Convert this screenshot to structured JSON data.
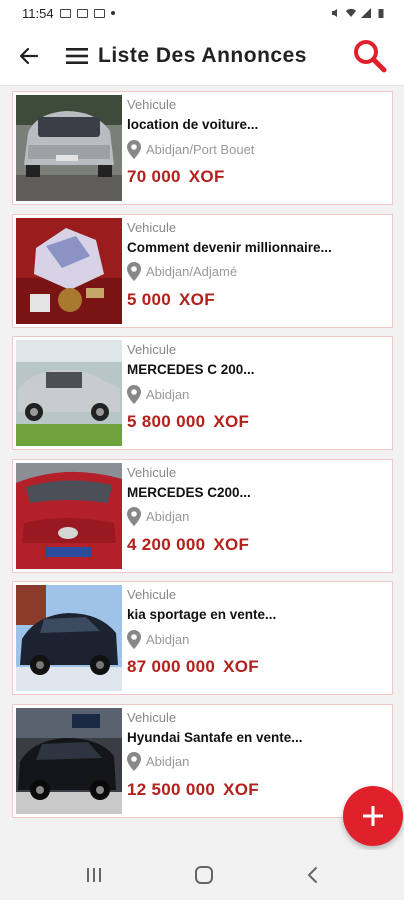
{
  "status": {
    "time": "11:54"
  },
  "header": {
    "title": "Liste Des Annonces"
  },
  "listings": [
    {
      "category": "Vehicule",
      "title": "location de voiture...",
      "location": "Abidjan/Port Bouet",
      "amount": "70 000",
      "currency": "XOF"
    },
    {
      "category": "Vehicule",
      "title": " Comment devenir millionnaire...",
      "location": "Abidjan/Adjamé",
      "amount": "5 000",
      "currency": "XOF"
    },
    {
      "category": "Vehicule",
      "title": "MERCEDES C 200...",
      "location": "Abidjan",
      "amount": "5 800 000",
      "currency": "XOF"
    },
    {
      "category": "Vehicule",
      "title": "MERCEDES C200...",
      "location": "Abidjan",
      "amount": "4 200 000",
      "currency": "XOF"
    },
    {
      "category": "Vehicule",
      "title": "kia sportage en vente...",
      "location": "Abidjan",
      "amount": "87 000 000",
      "currency": "XOF"
    },
    {
      "category": "Vehicule",
      "title": "Hyundai Santafe en vente...",
      "location": "Abidjan",
      "amount": "12 500 000",
      "currency": "XOF"
    }
  ],
  "fab": {
    "icon": "plus-icon",
    "color": "#e0202b"
  },
  "colors": {
    "accent": "#e0202b",
    "price": "#b3211c"
  }
}
